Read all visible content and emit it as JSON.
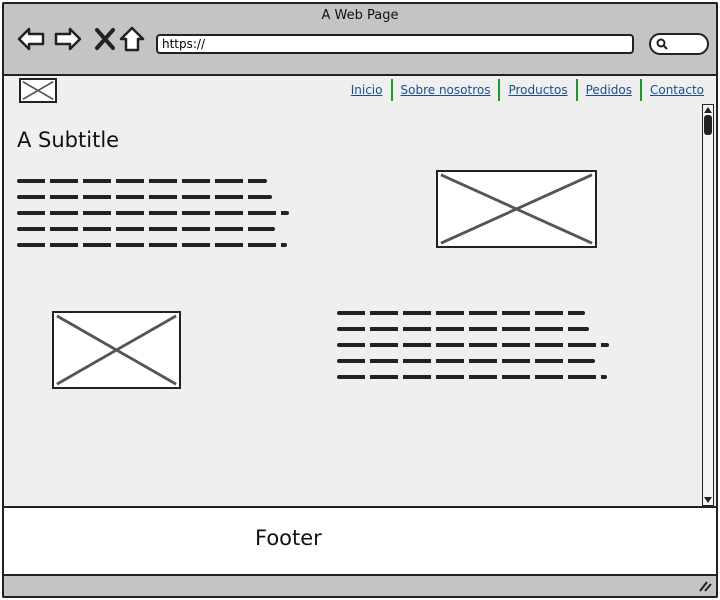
{
  "window": {
    "title": "A Web Page"
  },
  "browser": {
    "url": "https://"
  },
  "nav": {
    "items": [
      {
        "label": "Inicio"
      },
      {
        "label": "Sobre nosotros"
      },
      {
        "label": "Productos"
      },
      {
        "label": "Pedidos"
      },
      {
        "label": "Contacto"
      }
    ],
    "link_color": "#1a4f8a",
    "separator_color": "#1d9a2f"
  },
  "main": {
    "subtitle": "A Subtitle"
  },
  "footer": {
    "label": "Footer"
  },
  "icons": {
    "back": "arrow-left-icon",
    "forward": "arrow-right-icon",
    "stop": "close-icon",
    "home": "home-icon",
    "search": "search-icon"
  }
}
